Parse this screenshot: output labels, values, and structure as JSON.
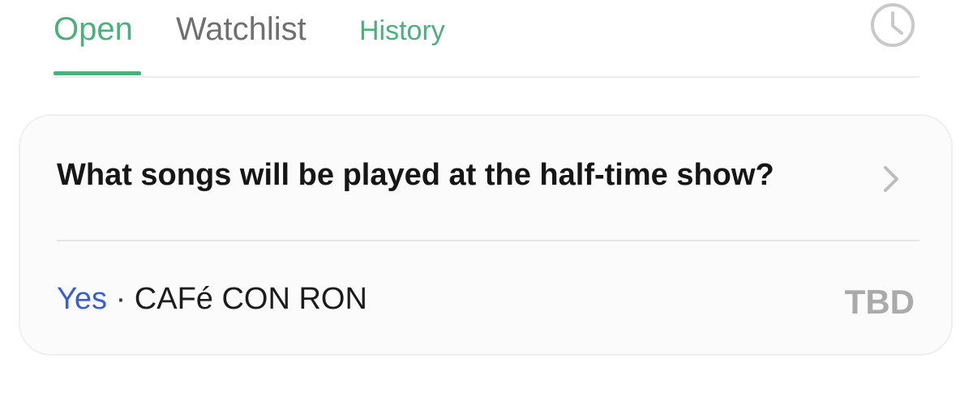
{
  "tabs": [
    {
      "label": "Open",
      "active": true
    },
    {
      "label": "Watchlist",
      "active": false
    },
    {
      "label": "History",
      "active": false
    }
  ],
  "history_icon": "clock-icon",
  "colors": {
    "accent": "#4caf7e",
    "tab_inactive": "#6f6f6f",
    "answer": "#3a5fcd",
    "status": "#aaaaaa"
  },
  "card": {
    "question": "What songs will be played at the half-time show?",
    "chevron_icon": "chevron-right-icon",
    "answer": "Yes",
    "separator": "·",
    "selection": "CAFé CON RON",
    "status": "TBD"
  }
}
